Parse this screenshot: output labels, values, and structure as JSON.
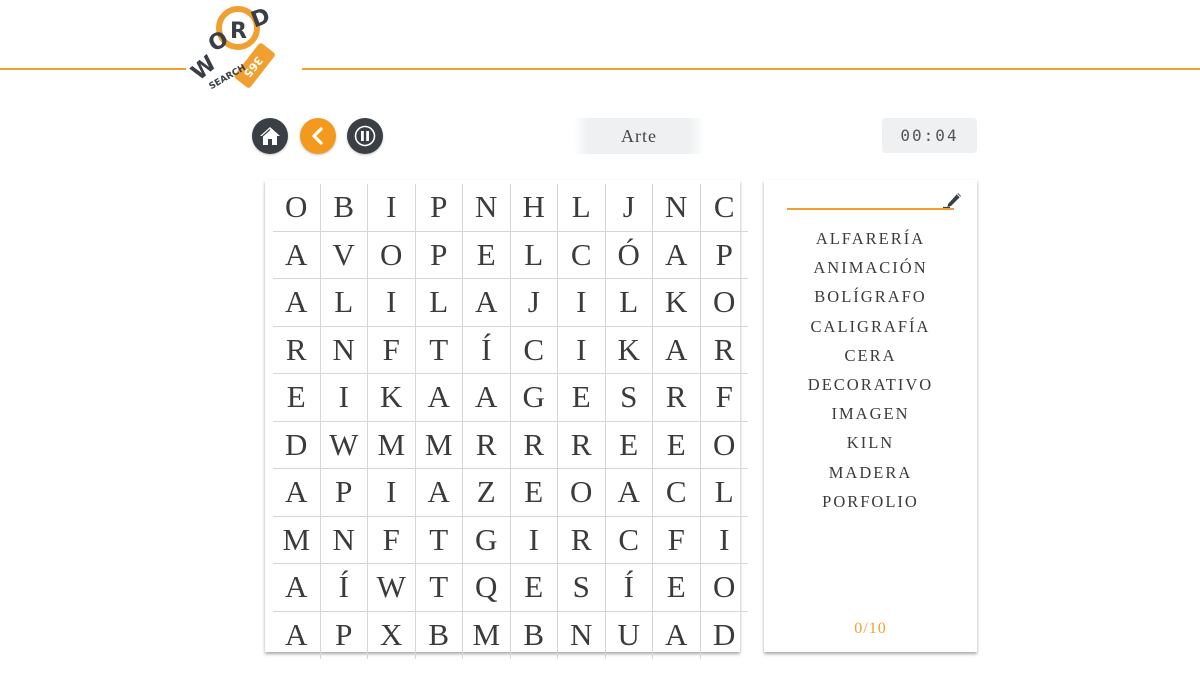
{
  "logo": {
    "top_text": "WORD",
    "bottom_text": "SEARCH",
    "badge_text": "365"
  },
  "toolbar": {
    "home_icon": "home-icon",
    "back_icon": "chevron-left-icon",
    "pause_icon": "pause-icon",
    "category": "Arte",
    "timer": "00:04"
  },
  "colors": {
    "accent": "#f39a1e",
    "dark_button": "#3a3f45",
    "text": "#3b3b3b",
    "grid_line": "#d6d6d6"
  },
  "grid": [
    [
      "O",
      "B",
      "I",
      "P",
      "N",
      "H",
      "L",
      "J",
      "N",
      "C"
    ],
    [
      "A",
      "V",
      "O",
      "P",
      "E",
      "L",
      "C",
      "Ó",
      "A",
      "P"
    ],
    [
      "A",
      "L",
      "I",
      "L",
      "A",
      "J",
      "I",
      "L",
      "K",
      "O"
    ],
    [
      "R",
      "N",
      "F",
      "T",
      "Í",
      "C",
      "I",
      "K",
      "A",
      "R"
    ],
    [
      "E",
      "I",
      "K",
      "A",
      "A",
      "G",
      "E",
      "S",
      "R",
      "F"
    ],
    [
      "D",
      "W",
      "M",
      "M",
      "R",
      "R",
      "R",
      "E",
      "E",
      "O"
    ],
    [
      "A",
      "P",
      "I",
      "A",
      "Z",
      "E",
      "O",
      "A",
      "C",
      "L"
    ],
    [
      "M",
      "N",
      "F",
      "T",
      "G",
      "I",
      "R",
      "C",
      "F",
      "I"
    ],
    [
      "A",
      "Í",
      "W",
      "T",
      "Q",
      "E",
      "S",
      "Í",
      "E",
      "O"
    ],
    [
      "A",
      "P",
      "X",
      "B",
      "M",
      "B",
      "N",
      "U",
      "A",
      "D"
    ]
  ],
  "words": [
    "ALFARERÍA",
    "ANIMACIÓN",
    "BOLÍGRAFO",
    "CALIGRAFÍA",
    "CERA",
    "DECORATIVO",
    "IMAGEN",
    "KILN",
    "MADERA",
    "PORFOLIO"
  ],
  "pen_icon": "pencil-icon",
  "progress": "0/10"
}
